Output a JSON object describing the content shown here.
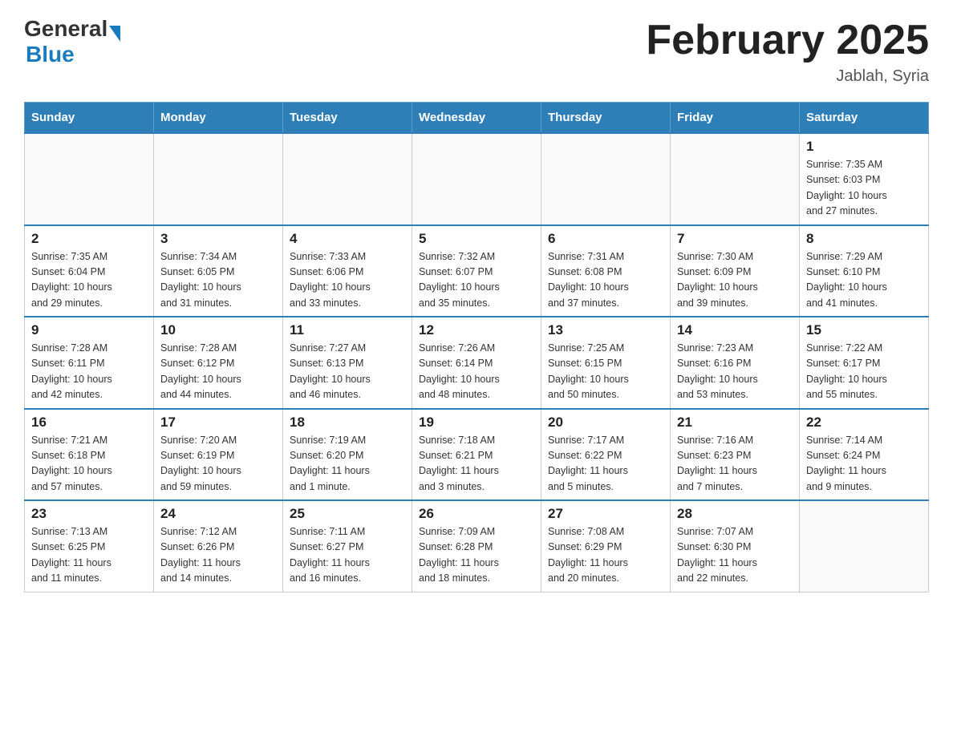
{
  "header": {
    "logo_general": "General",
    "logo_blue": "Blue",
    "title": "February 2025",
    "subtitle": "Jablah, Syria"
  },
  "days_of_week": [
    "Sunday",
    "Monday",
    "Tuesday",
    "Wednesday",
    "Thursday",
    "Friday",
    "Saturday"
  ],
  "weeks": [
    [
      {
        "day": "",
        "info": ""
      },
      {
        "day": "",
        "info": ""
      },
      {
        "day": "",
        "info": ""
      },
      {
        "day": "",
        "info": ""
      },
      {
        "day": "",
        "info": ""
      },
      {
        "day": "",
        "info": ""
      },
      {
        "day": "1",
        "info": "Sunrise: 7:35 AM\nSunset: 6:03 PM\nDaylight: 10 hours\nand 27 minutes."
      }
    ],
    [
      {
        "day": "2",
        "info": "Sunrise: 7:35 AM\nSunset: 6:04 PM\nDaylight: 10 hours\nand 29 minutes."
      },
      {
        "day": "3",
        "info": "Sunrise: 7:34 AM\nSunset: 6:05 PM\nDaylight: 10 hours\nand 31 minutes."
      },
      {
        "day": "4",
        "info": "Sunrise: 7:33 AM\nSunset: 6:06 PM\nDaylight: 10 hours\nand 33 minutes."
      },
      {
        "day": "5",
        "info": "Sunrise: 7:32 AM\nSunset: 6:07 PM\nDaylight: 10 hours\nand 35 minutes."
      },
      {
        "day": "6",
        "info": "Sunrise: 7:31 AM\nSunset: 6:08 PM\nDaylight: 10 hours\nand 37 minutes."
      },
      {
        "day": "7",
        "info": "Sunrise: 7:30 AM\nSunset: 6:09 PM\nDaylight: 10 hours\nand 39 minutes."
      },
      {
        "day": "8",
        "info": "Sunrise: 7:29 AM\nSunset: 6:10 PM\nDaylight: 10 hours\nand 41 minutes."
      }
    ],
    [
      {
        "day": "9",
        "info": "Sunrise: 7:28 AM\nSunset: 6:11 PM\nDaylight: 10 hours\nand 42 minutes."
      },
      {
        "day": "10",
        "info": "Sunrise: 7:28 AM\nSunset: 6:12 PM\nDaylight: 10 hours\nand 44 minutes."
      },
      {
        "day": "11",
        "info": "Sunrise: 7:27 AM\nSunset: 6:13 PM\nDaylight: 10 hours\nand 46 minutes."
      },
      {
        "day": "12",
        "info": "Sunrise: 7:26 AM\nSunset: 6:14 PM\nDaylight: 10 hours\nand 48 minutes."
      },
      {
        "day": "13",
        "info": "Sunrise: 7:25 AM\nSunset: 6:15 PM\nDaylight: 10 hours\nand 50 minutes."
      },
      {
        "day": "14",
        "info": "Sunrise: 7:23 AM\nSunset: 6:16 PM\nDaylight: 10 hours\nand 53 minutes."
      },
      {
        "day": "15",
        "info": "Sunrise: 7:22 AM\nSunset: 6:17 PM\nDaylight: 10 hours\nand 55 minutes."
      }
    ],
    [
      {
        "day": "16",
        "info": "Sunrise: 7:21 AM\nSunset: 6:18 PM\nDaylight: 10 hours\nand 57 minutes."
      },
      {
        "day": "17",
        "info": "Sunrise: 7:20 AM\nSunset: 6:19 PM\nDaylight: 10 hours\nand 59 minutes."
      },
      {
        "day": "18",
        "info": "Sunrise: 7:19 AM\nSunset: 6:20 PM\nDaylight: 11 hours\nand 1 minute."
      },
      {
        "day": "19",
        "info": "Sunrise: 7:18 AM\nSunset: 6:21 PM\nDaylight: 11 hours\nand 3 minutes."
      },
      {
        "day": "20",
        "info": "Sunrise: 7:17 AM\nSunset: 6:22 PM\nDaylight: 11 hours\nand 5 minutes."
      },
      {
        "day": "21",
        "info": "Sunrise: 7:16 AM\nSunset: 6:23 PM\nDaylight: 11 hours\nand 7 minutes."
      },
      {
        "day": "22",
        "info": "Sunrise: 7:14 AM\nSunset: 6:24 PM\nDaylight: 11 hours\nand 9 minutes."
      }
    ],
    [
      {
        "day": "23",
        "info": "Sunrise: 7:13 AM\nSunset: 6:25 PM\nDaylight: 11 hours\nand 11 minutes."
      },
      {
        "day": "24",
        "info": "Sunrise: 7:12 AM\nSunset: 6:26 PM\nDaylight: 11 hours\nand 14 minutes."
      },
      {
        "day": "25",
        "info": "Sunrise: 7:11 AM\nSunset: 6:27 PM\nDaylight: 11 hours\nand 16 minutes."
      },
      {
        "day": "26",
        "info": "Sunrise: 7:09 AM\nSunset: 6:28 PM\nDaylight: 11 hours\nand 18 minutes."
      },
      {
        "day": "27",
        "info": "Sunrise: 7:08 AM\nSunset: 6:29 PM\nDaylight: 11 hours\nand 20 minutes."
      },
      {
        "day": "28",
        "info": "Sunrise: 7:07 AM\nSunset: 6:30 PM\nDaylight: 11 hours\nand 22 minutes."
      },
      {
        "day": "",
        "info": ""
      }
    ]
  ]
}
